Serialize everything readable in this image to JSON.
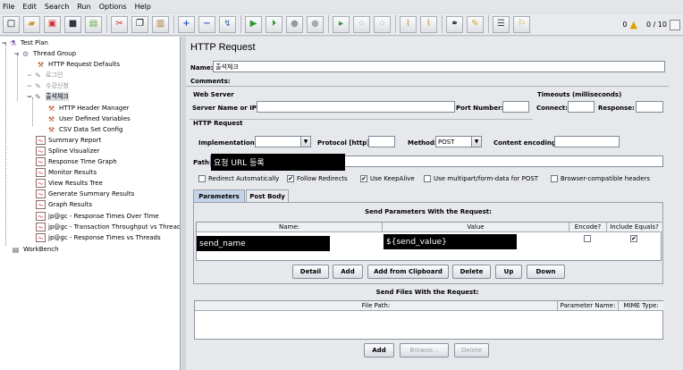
{
  "menu": [
    "File",
    "Edit",
    "Search",
    "Run",
    "Options",
    "Help"
  ],
  "toolbar": {
    "icons": [
      "new-icon",
      "open-icon",
      "close-icon",
      "save-icon",
      "save-as-icon",
      "cut-icon",
      "copy-icon",
      "paste-icon",
      "expand-icon",
      "collapse-icon",
      "toggle-icon",
      "start-icon",
      "start-no-pause-icon",
      "stop-icon",
      "shutdown-icon",
      "remote-start-icon",
      "remote-stop-icon",
      "remote-exit-icon",
      "clear-icon",
      "clear-all-icon",
      "search-icon",
      "reset-search-icon",
      "function-helper-icon",
      "help-icon"
    ],
    "warning_count": "0",
    "thread_counter": "0 / 10"
  },
  "tree": {
    "items": [
      {
        "label": "Test Plan",
        "icon": "test-plan-icon"
      },
      {
        "label": "Thread Group",
        "icon": "thread-group-icon"
      },
      {
        "label": "HTTP Request Defaults",
        "icon": "config-icon"
      },
      {
        "label": "로그인",
        "icon": "sampler-icon"
      },
      {
        "label": "수강신청",
        "icon": "sampler-icon"
      },
      {
        "label": "출석체크",
        "icon": "sampler-icon"
      },
      {
        "label": "HTTP Header Manager",
        "icon": "config-icon"
      },
      {
        "label": "User Defined Variables",
        "icon": "config-icon"
      },
      {
        "label": "CSV Data Set Config",
        "icon": "config-icon"
      },
      {
        "label": "Summary Report",
        "icon": "listener-icon"
      },
      {
        "label": "Spline Visualizer",
        "icon": "listener-icon"
      },
      {
        "label": "Response Time Graph",
        "icon": "listener-icon"
      },
      {
        "label": "Monitor Results",
        "icon": "listener-icon"
      },
      {
        "label": "View Results Tree",
        "icon": "listener-icon"
      },
      {
        "label": "Generate Summary Results",
        "icon": "listener-icon"
      },
      {
        "label": "Graph Results",
        "icon": "listener-icon"
      },
      {
        "label": "jp@gc - Response Times Over Time",
        "icon": "listener-icon"
      },
      {
        "label": "jp@gc - Transaction Throughput vs Threads",
        "icon": "listener-icon"
      },
      {
        "label": "jp@gc - Response Times vs Threads",
        "icon": "listener-icon"
      },
      {
        "label": "WorkBench",
        "icon": "workbench-icon"
      }
    ]
  },
  "panel": {
    "title": "HTTP Request",
    "name_label": "Name:",
    "name_value": "출석체크",
    "comments_label": "Comments:",
    "web_server": {
      "title": "Web Server",
      "server_label": "Server Name or IP:",
      "server_value": "",
      "port_label": "Port Number:",
      "port_value": ""
    },
    "timeouts": {
      "title": "Timeouts (milliseconds)",
      "connect_label": "Connect:",
      "response_label": "Response:"
    },
    "http_request": {
      "title": "HTTP Request",
      "impl_label": "Implementation:",
      "impl_value": "",
      "protocol_label": "Protocol [http]:",
      "method_label": "Method:",
      "method_value": "POST",
      "encoding_label": "Content encoding:",
      "path_label": "Path:",
      "path_value": "요청 URL 등록"
    },
    "options": [
      {
        "label": "Redirect Automatically",
        "checked": false
      },
      {
        "label": "Follow Redirects",
        "checked": true
      },
      {
        "label": "Use KeepAlive",
        "checked": true
      },
      {
        "label": "Use multipart/form-data for POST",
        "checked": false
      },
      {
        "label": "Browser-compatible headers",
        "checked": false
      }
    ],
    "tabs": [
      "Parameters",
      "Post Body"
    ],
    "params": {
      "title": "Send Parameters With the Request:",
      "columns": [
        "Name:",
        "Value",
        "Encode?",
        "Include Equals?"
      ],
      "rows": [
        {
          "name": "send_name",
          "value": "${send_value}",
          "encode": false,
          "include_equals": true
        }
      ],
      "buttons": [
        "Detail",
        "Add",
        "Add from Clipboard",
        "Delete",
        "Up",
        "Down"
      ]
    },
    "files": {
      "title": "Send Files With the Request:",
      "columns": [
        "File Path:",
        "Parameter Name:",
        "MIME Type:"
      ],
      "buttons": [
        "Add",
        "Browse...",
        "Delete"
      ]
    }
  }
}
